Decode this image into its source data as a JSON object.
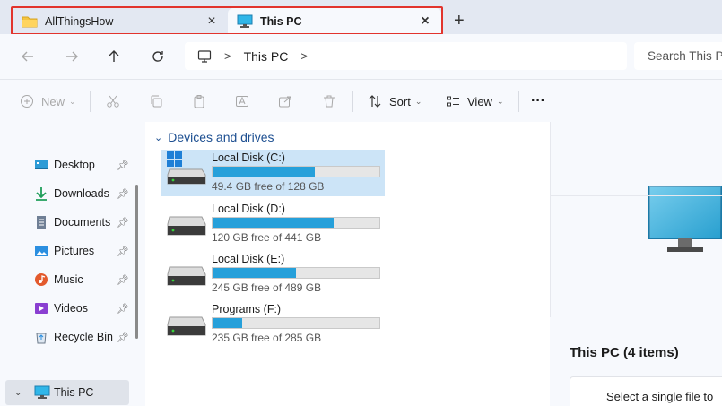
{
  "tabs": [
    {
      "label": "AllThingsHow",
      "icon": "folder-icon",
      "active": false
    },
    {
      "label": "This PC",
      "icon": "monitor-icon",
      "active": true
    }
  ],
  "new_tab": "+",
  "breadcrumb": {
    "items": [
      "This PC"
    ]
  },
  "search": {
    "placeholder": "Search This PC"
  },
  "commands": {
    "new": "New",
    "sort": "Sort",
    "view": "View",
    "more": "···"
  },
  "sidebar": {
    "items": [
      {
        "label": "Desktop",
        "icon": "desktop-icon",
        "pinned": true
      },
      {
        "label": "Downloads",
        "icon": "downloads-icon",
        "pinned": true
      },
      {
        "label": "Documents",
        "icon": "documents-icon",
        "pinned": true
      },
      {
        "label": "Pictures",
        "icon": "pictures-icon",
        "pinned": true
      },
      {
        "label": "Music",
        "icon": "music-icon",
        "pinned": true
      },
      {
        "label": "Videos",
        "icon": "videos-icon",
        "pinned": true
      },
      {
        "label": "Recycle Bin",
        "icon": "recycle-bin-icon",
        "pinned": true
      },
      {
        "label": "This PC",
        "icon": "this-pc-icon",
        "selected": true
      }
    ]
  },
  "main": {
    "group_title": "Devices and drives",
    "drives": [
      {
        "name": "Local Disk (C:)",
        "free_text": "49.4 GB free of 128 GB",
        "used_fraction": 0.614,
        "selected": true
      },
      {
        "name": "Local Disk (D:)",
        "free_text": "120 GB free of 441 GB",
        "used_fraction": 0.728
      },
      {
        "name": "Local Disk (E:)",
        "free_text": "245 GB free of 489 GB",
        "used_fraction": 0.499
      },
      {
        "name": "Programs (F:)",
        "free_text": "235 GB free of 285 GB",
        "used_fraction": 0.175
      }
    ]
  },
  "details": {
    "title": "This PC (4 items)",
    "hint": "Select a single file to"
  },
  "colors": {
    "accent": "#26a0da",
    "selection": "#cce4f7",
    "highlight_box": "#e2342d",
    "group_header": "#1d4f91"
  }
}
